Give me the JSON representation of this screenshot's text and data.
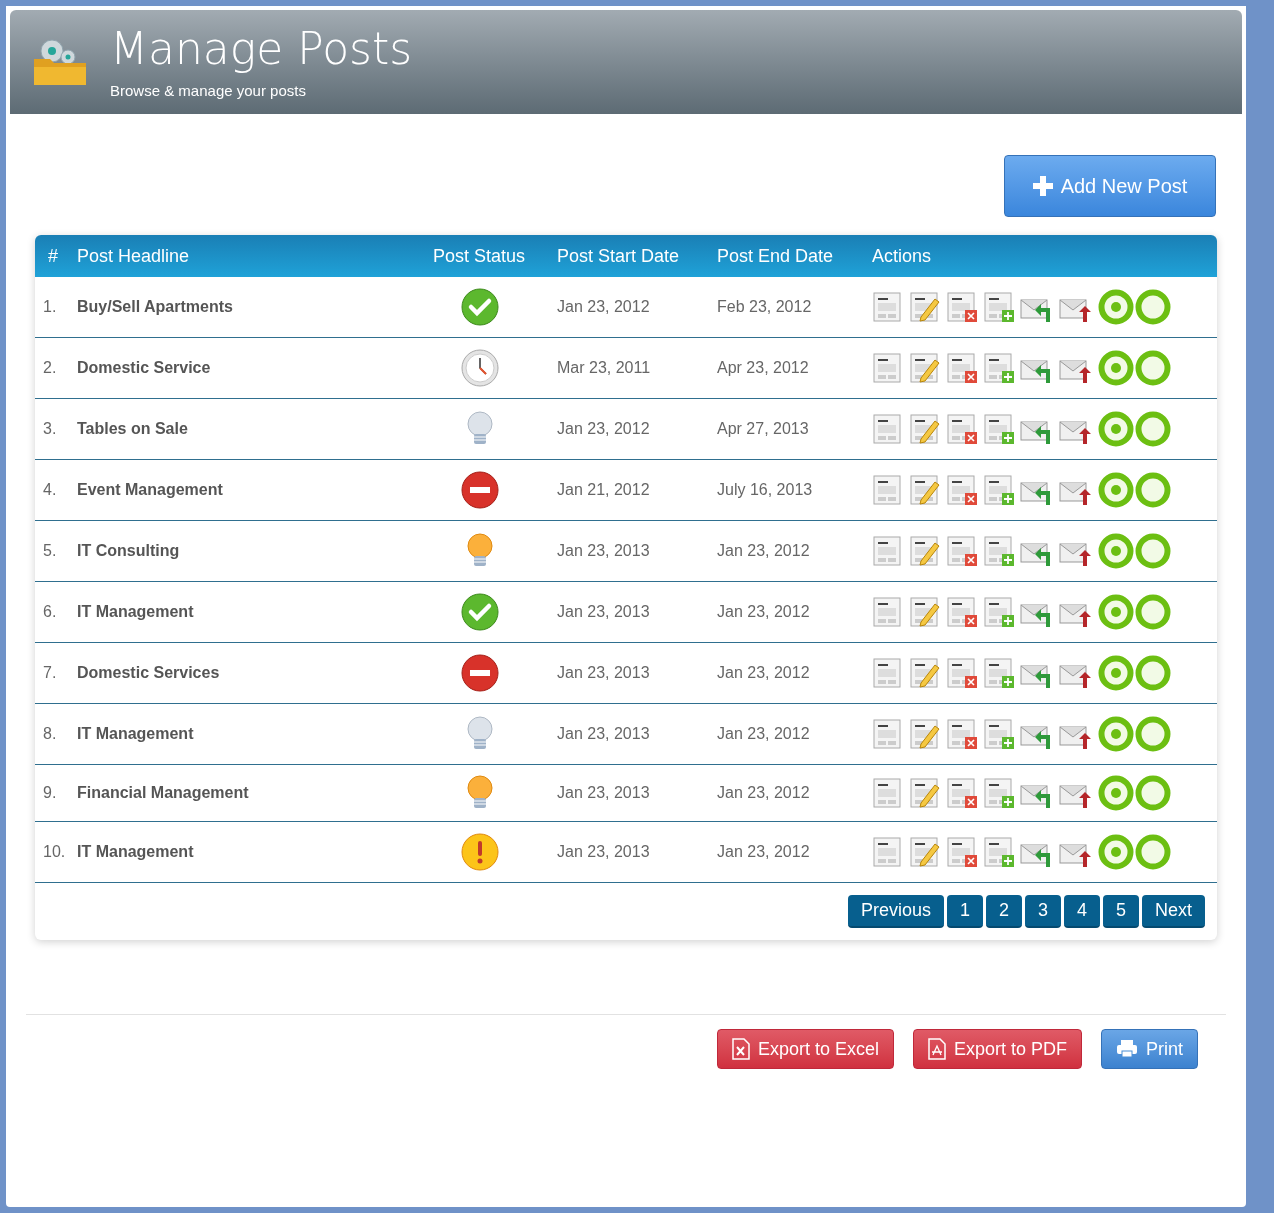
{
  "header": {
    "title": "Manage Posts",
    "subtitle": "Browse & manage your posts"
  },
  "add_button": "Add New Post",
  "table": {
    "columns": [
      "#",
      "Post Headline",
      "Post Status",
      "Post Start Date",
      "Post End Date",
      "Actions"
    ],
    "rows": [
      {
        "number": "1.",
        "headline": "Buy/Sell Apartments",
        "kind": "approved",
        "start": "Jan 23, 2012",
        "end": "Feb 23, 2012"
      },
      {
        "number": "2.",
        "headline": "Domestic Service",
        "kind": "pending",
        "start": "Mar 23, 2011",
        "end": "Apr 23, 2012"
      },
      {
        "number": "3.",
        "headline": "Tables on Sale",
        "kind": "idle",
        "start": "Jan 23, 2012",
        "end": "Apr 27, 2013"
      },
      {
        "number": "4.",
        "headline": "Event Management",
        "kind": "blocked",
        "start": "Jan 21, 2012",
        "end": "July 16, 2013"
      },
      {
        "number": "5.",
        "headline": "IT Consulting",
        "kind": "active",
        "start": "Jan 23, 2013",
        "end": "Jan 23, 2012"
      },
      {
        "number": "6.",
        "headline": "IT Management",
        "kind": "approved",
        "start": "Jan 23, 2013",
        "end": "Jan 23, 2012"
      },
      {
        "number": "7.",
        "headline": "Domestic Services",
        "kind": "blocked",
        "start": "Jan 23, 2013",
        "end": "Jan 23, 2012"
      },
      {
        "number": "8.",
        "headline": "IT Management",
        "kind": "idle",
        "start": "Jan 23, 2013",
        "end": "Jan 23, 2012"
      },
      {
        "number": "9.",
        "headline": "Financial Management",
        "kind": "active",
        "start": "Jan 23, 2013",
        "end": "Jan 23, 2012"
      },
      {
        "number": "10.",
        "headline": "IT Management",
        "kind": "warning",
        "start": "Jan 23, 2013",
        "end": "Jan 23, 2012"
      }
    ]
  },
  "pagination": [
    "Previous",
    "1",
    "2",
    "3",
    "4",
    "5",
    "Next"
  ],
  "export_buttons": [
    {
      "kind": "excel",
      "label": "Export to Excel"
    },
    {
      "kind": "pdf",
      "label": "Export to PDF"
    },
    {
      "kind": "print",
      "label": "Print"
    }
  ]
}
